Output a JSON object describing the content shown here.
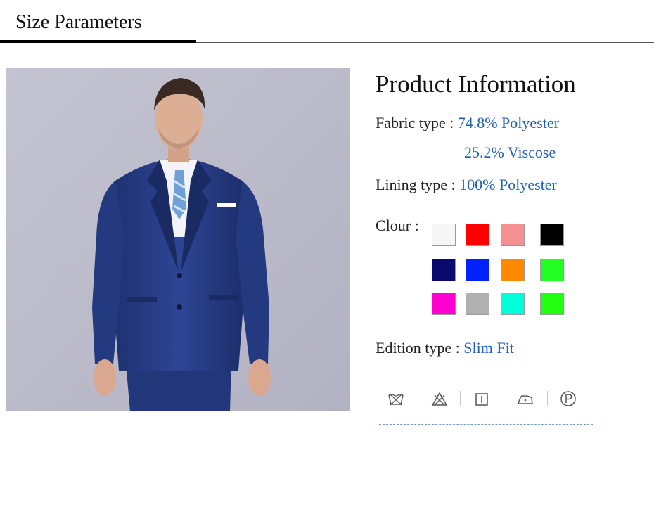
{
  "header": {
    "title": "Size Parameters"
  },
  "product_info": {
    "title": "Product Information",
    "fabric_label": "Fabric type :",
    "fabric_value_1": "74.8% Polyester",
    "fabric_value_2": "25.2% Viscose",
    "lining_label": "Lining type :",
    "lining_value": "100% Polyester",
    "colour_label": "Clour :",
    "edition_label": "Edition type :",
    "edition_value": "Slim Fit"
  },
  "colours": [
    "#f6f6f6",
    "#ff0000",
    "#f49090",
    "#000000",
    "#0a0a6e",
    "#0022ff",
    "#ff8a00",
    "#22ff22",
    "#ff00d0",
    "#b0b0b0",
    "#00ffd8",
    "#22ff11"
  ],
  "care_icons": [
    "do-not-wash-icon",
    "do-not-bleach-icon",
    "tumble-dry-icon",
    "iron-icon",
    "dry-clean-p-icon"
  ],
  "photo": {
    "description_icon": "man-in-blue-suit-photo",
    "background": "#bdbccb"
  }
}
